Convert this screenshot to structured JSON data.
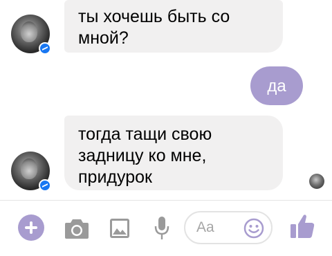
{
  "messages": [
    {
      "sender": "them",
      "text": "ты хочешь быть со\nмной?"
    },
    {
      "sender": "me",
      "text": "да"
    },
    {
      "sender": "them",
      "text": "тогда тащи свою\nзадницу ко мне,\nпридурок"
    }
  ],
  "composer": {
    "placeholder": "Aa",
    "icons": [
      "plus-icon",
      "camera-icon",
      "gallery-icon",
      "microphone-icon",
      "emoji-icon",
      "thumbs-up-icon"
    ]
  },
  "colors": {
    "accent": "#a89ccf",
    "incoming_bubble": "#f1f0f0",
    "outgoing_text": "#ffffff",
    "icon_gray": "#9a9a9a",
    "messenger_badge": "#1877f2"
  }
}
